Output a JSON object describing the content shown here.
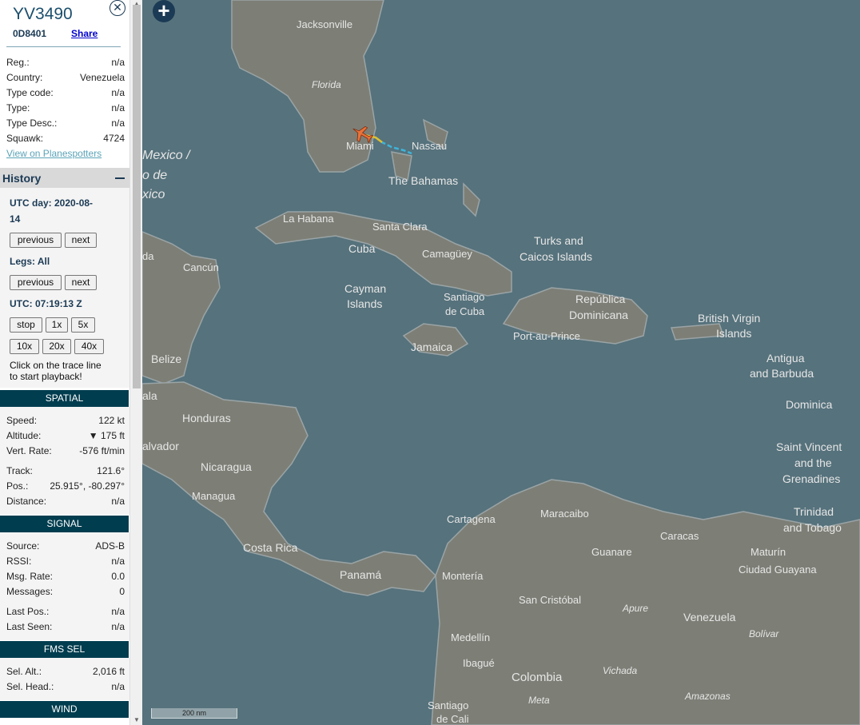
{
  "aircraft": {
    "callsign": "YV3490",
    "hex": "0D8401",
    "share_label": "Share",
    "close_label": "✕"
  },
  "info": {
    "reg_label": "Reg.:",
    "reg": "n/a",
    "country_label": "Country:",
    "country": "Venezuela",
    "typecode_label": "Type code:",
    "typecode": "n/a",
    "type_label": "Type:",
    "type": "n/a",
    "typedesc_label": "Type Desc.:",
    "typedesc": "n/a",
    "squawk_label": "Squawk:",
    "squawk": "4724",
    "planespotters_link": "View on Planespotters"
  },
  "history": {
    "title": "History",
    "utc_day": "UTC day: 2020-08-",
    "utc_day_cont": "14",
    "prev_label": "previous",
    "next_label": "next",
    "legs": "Legs: All",
    "utc_time": "UTC: 07:19:13 Z",
    "speed_buttons": [
      "stop",
      "1x",
      "5x",
      "10x",
      "20x",
      "40x"
    ],
    "hint_line1": "Click on the trace line",
    "hint_line2": "to start playback!"
  },
  "spatial": {
    "title": "SPATIAL",
    "speed_label": "Speed:",
    "speed": "122 kt",
    "altitude_label": "Altitude:",
    "altitude": "▼ 175 ft",
    "vrate_label": "Vert. Rate:",
    "vrate": "-576 ft/min",
    "track_label": "Track:",
    "track": "121.6°",
    "pos_label": "Pos.:",
    "pos": "25.915°, -80.297°",
    "distance_label": "Distance:",
    "distance": "n/a"
  },
  "signal": {
    "title": "SIGNAL",
    "source_label": "Source:",
    "source": "ADS-B",
    "rssi_label": "RSSI:",
    "rssi": "n/a",
    "msgrate_label": "Msg. Rate:",
    "msgrate": "0.0",
    "messages_label": "Messages:",
    "messages": "0",
    "lastpos_label": "Last Pos.:",
    "lastpos": "n/a",
    "lastseen_label": "Last Seen:",
    "lastseen": "n/a"
  },
  "fms": {
    "title": "FMS SEL",
    "selalt_label": "Sel. Alt.:",
    "selalt": "2,016 ft",
    "selhead_label": "Sel. Head.:",
    "selhead": "n/a"
  },
  "wind": {
    "title": "WIND"
  },
  "map": {
    "scale_label": "200 nm",
    "zoom_label": "+",
    "colors": {
      "water": "#56727c",
      "land": "#7d7f76",
      "label": "#e6e6e6",
      "plane": "#e8733a"
    },
    "labels": {
      "jacksonville": "Jacksonville",
      "florida": "Florida",
      "miami": "Miami",
      "nassau": "Nassau",
      "bahamas": "The Bahamas",
      "mexico1": "Mexico /",
      "mexico2": "o de",
      "mexico3": "xico",
      "lahabana": "La Habana",
      "santaclara": "Santa Clara",
      "cuba": "Cuba",
      "camaguey": "Camagüey",
      "turks1": "Turks and",
      "turks2": "Caicos Islands",
      "da": "da",
      "cancun": "Cancún",
      "cayman1": "Cayman",
      "cayman2": "Islands",
      "santiagocuba1": "Santiago",
      "santiagocuba2": "de Cuba",
      "republica1": "República",
      "republica2": "Dominicana",
      "portauprince": "Port-au-Prince",
      "bvi1": "British Virgin",
      "bvi2": "Islands",
      "jamaica": "Jamaica",
      "belize": "Belize",
      "antigua1": "Antigua",
      "antigua2": "and Barbuda",
      "ala": "ala",
      "honduras": "Honduras",
      "dominica": "Dominica",
      "salvador": "alvador",
      "nicaragua": "Nicaragua",
      "managua": "Managua",
      "stvincent1": "Saint Vincent",
      "stvincent2": "and the",
      "stvincent3": "Grenadines",
      "cartagena": "Cartagena",
      "maracaibo": "Maracaibo",
      "trinidad1": "Trinidad",
      "trinidad2": "and Tobago",
      "caracas": "Caracas",
      "costarica": "Costa Rica",
      "guanare": "Guanare",
      "maturin": "Maturín",
      "panama": "Panamá",
      "monteria": "Montería",
      "ciudadguayana": "Ciudad Guayana",
      "sancristobal": "San Cristóbal",
      "apure": "Apure",
      "venezuela": "Venezuela",
      "medellin": "Medellín",
      "bolivar": "Bolívar",
      "ibague": "Ibagué",
      "vichada": "Vichada",
      "colombia": "Colombia",
      "meta": "Meta",
      "amazonas": "Amazonas",
      "santiagocali1": "Santiago",
      "santiagocali2": "de Cali"
    }
  }
}
